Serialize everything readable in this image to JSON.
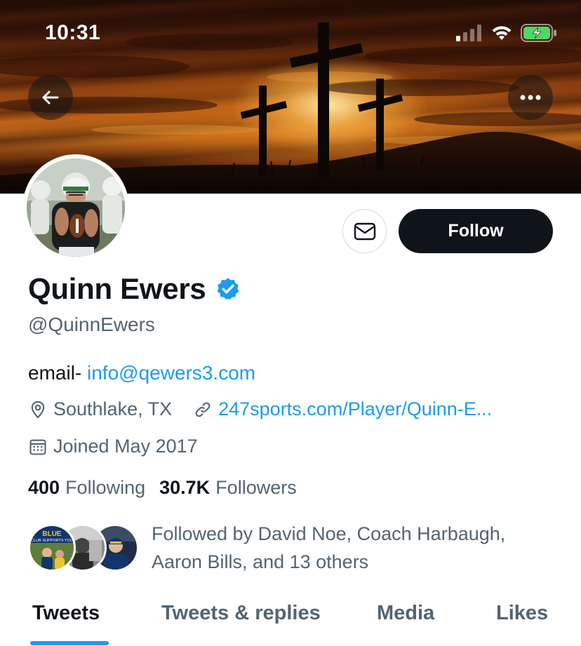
{
  "status_bar": {
    "time": "10:31"
  },
  "profile": {
    "display_name": "Quinn Ewers",
    "handle": "@QuinnEwers",
    "verified": true,
    "bio_prefix": "email- ",
    "bio_email": "info@qewers3.com",
    "location": "Southlake, TX",
    "website": "247sports.com/Player/Quinn-E...",
    "joined": "Joined May 2017",
    "following_count": "400",
    "following_label": "Following",
    "followers_count": "30.7K",
    "followers_label": "Followers",
    "followed_by_text": "Followed by David Noe, Coach Harbaugh, Aaron Bills, and 13 others"
  },
  "actions": {
    "follow_label": "Follow"
  },
  "tabs": [
    {
      "label": "Tweets",
      "active": true
    },
    {
      "label": "Tweets & replies",
      "active": false
    },
    {
      "label": "Media",
      "active": false
    },
    {
      "label": "Likes",
      "active": false
    }
  ],
  "mini_avatar_text": "BLUE CLUB SUPPORTS YOU",
  "icons": {
    "back": "arrow-left-icon",
    "more": "more-horizontal-icon",
    "message": "envelope-icon",
    "verified": "verified-badge-icon",
    "location": "location-pin-icon",
    "link": "link-icon",
    "calendar": "calendar-icon"
  },
  "colors": {
    "accent": "#1d9bf0",
    "text_primary": "#0f1419",
    "text_secondary": "#536471",
    "follow_bg": "#0f1419",
    "battery": "#4cd964"
  }
}
